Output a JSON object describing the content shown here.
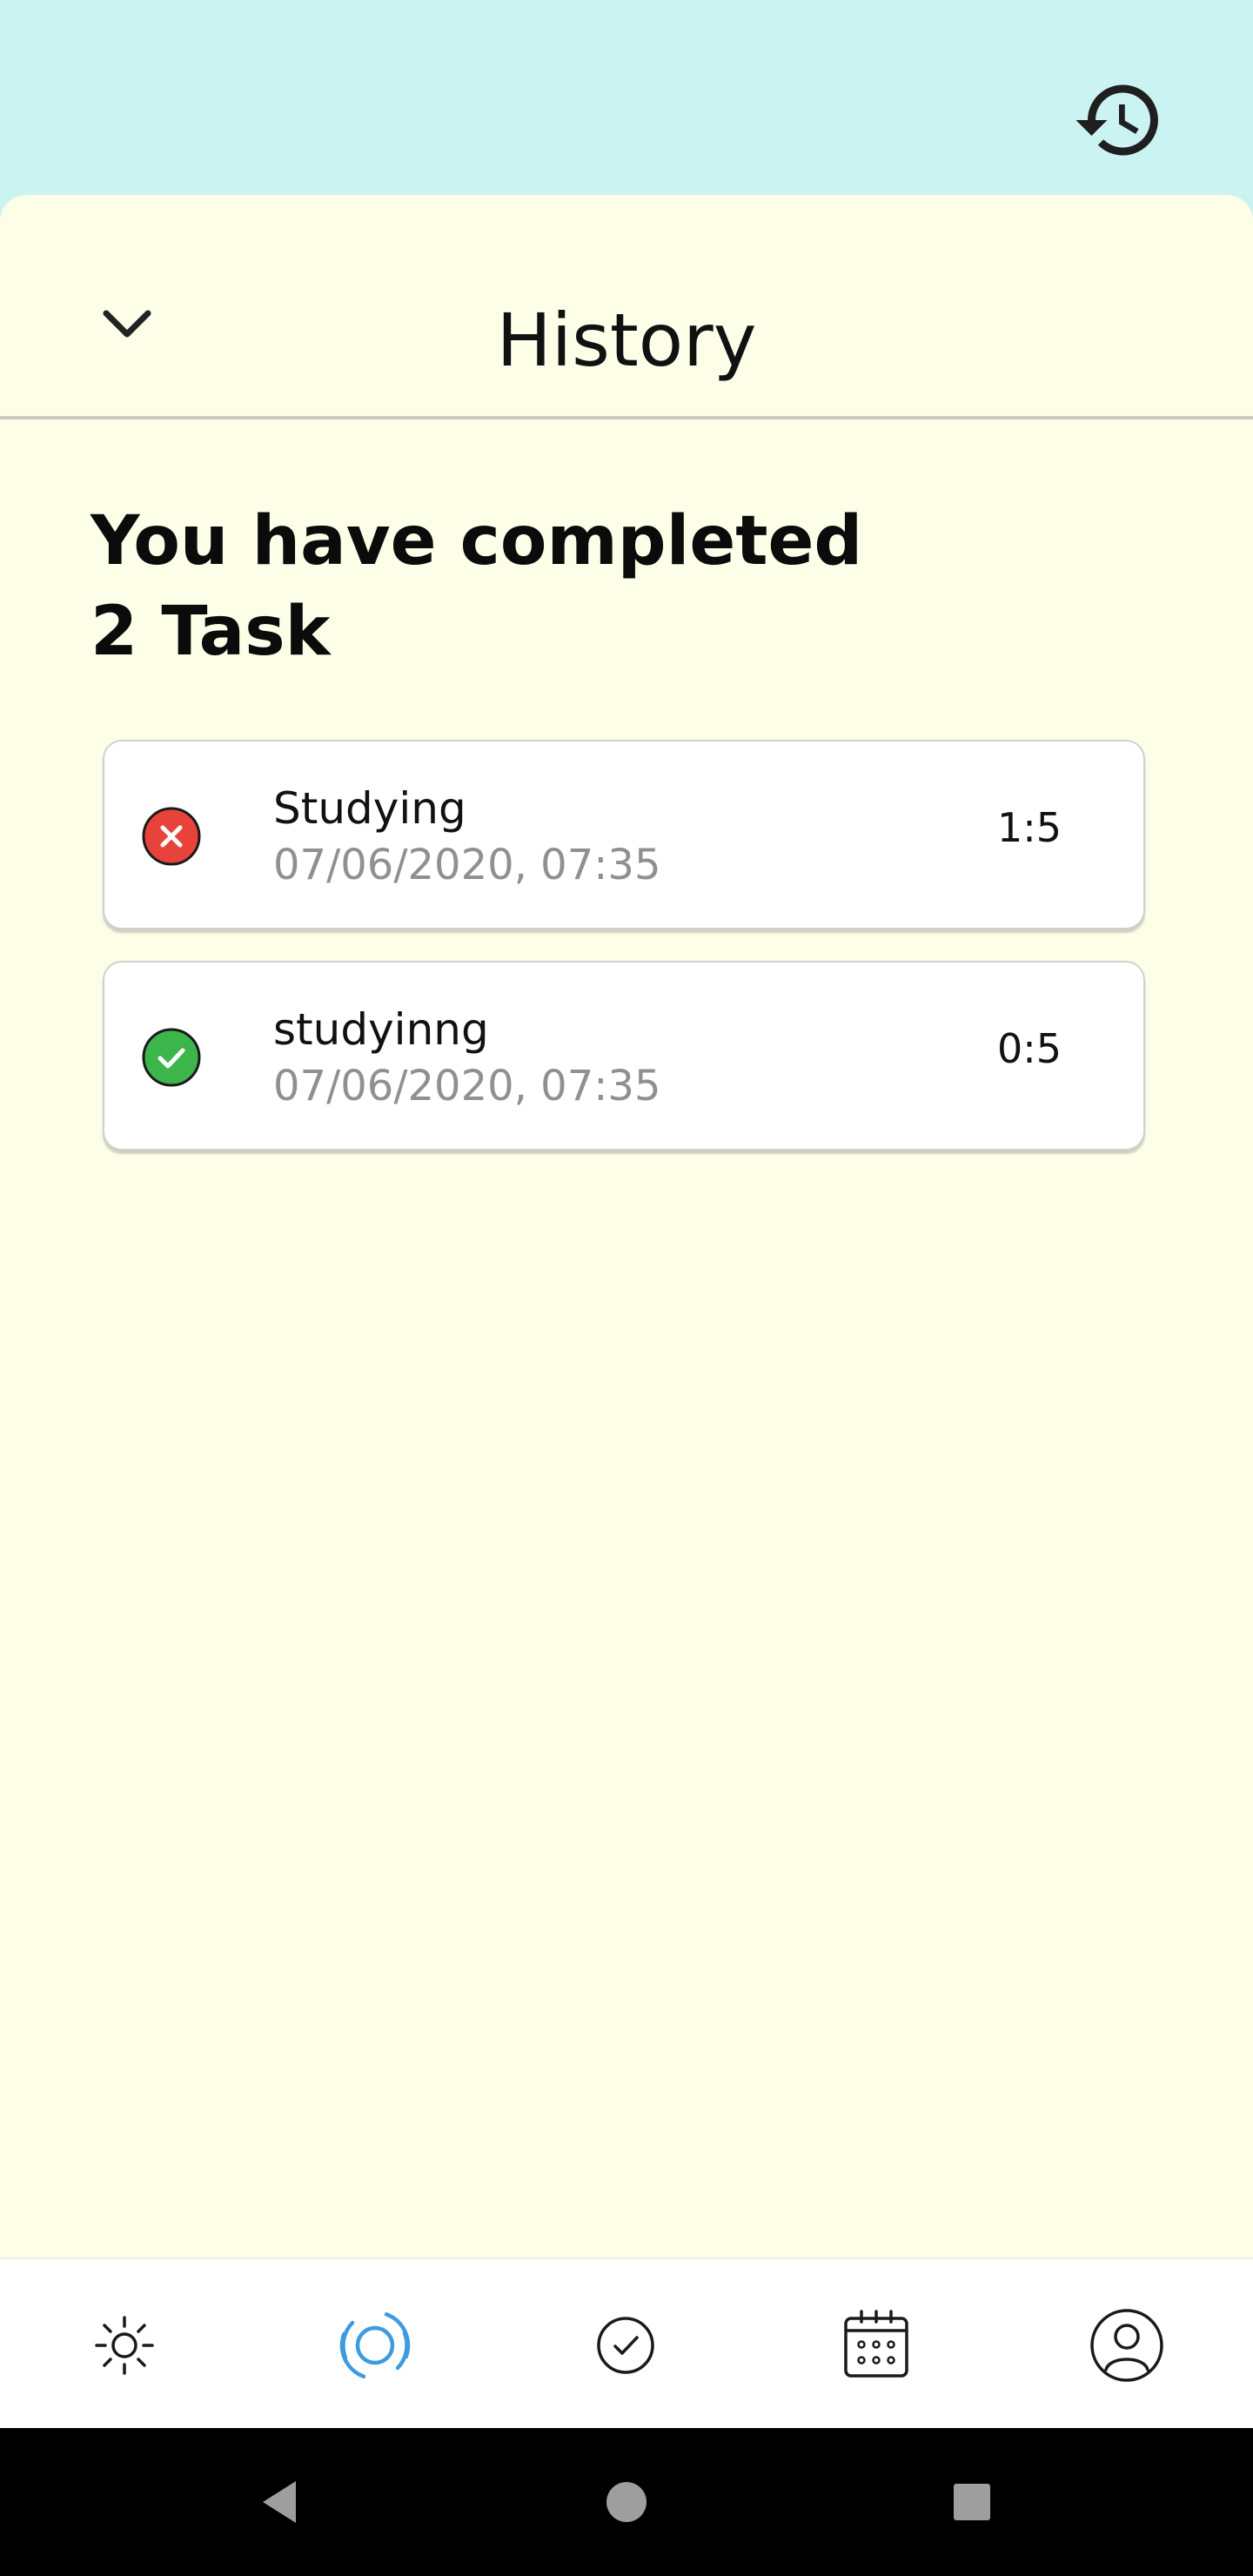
{
  "header": {
    "history_icon": "history-icon"
  },
  "sheet": {
    "collapse_icon": "chevron-down-icon",
    "title": "History",
    "summary_line1": "You have completed",
    "summary_line2": "2 Task"
  },
  "tasks": [
    {
      "name": "Studying",
      "date": "07/06/2020, 07:35",
      "time": "1:5",
      "status": "failed",
      "status_color": "#e8433b"
    },
    {
      "name": "studyinng",
      "date": "07/06/2020, 07:35",
      "time": "0:5",
      "status": "completed",
      "status_color": "#3cb54a"
    }
  ],
  "bottom_nav": {
    "active_color": "#3d9be0",
    "items": [
      "sun-icon",
      "focus-target-icon",
      "check-circle-icon",
      "calendar-icon",
      "profile-icon"
    ],
    "active_index": 1
  },
  "colors": {
    "top_band": "#cbf3f1",
    "sheet_background": "#fdfee8"
  }
}
